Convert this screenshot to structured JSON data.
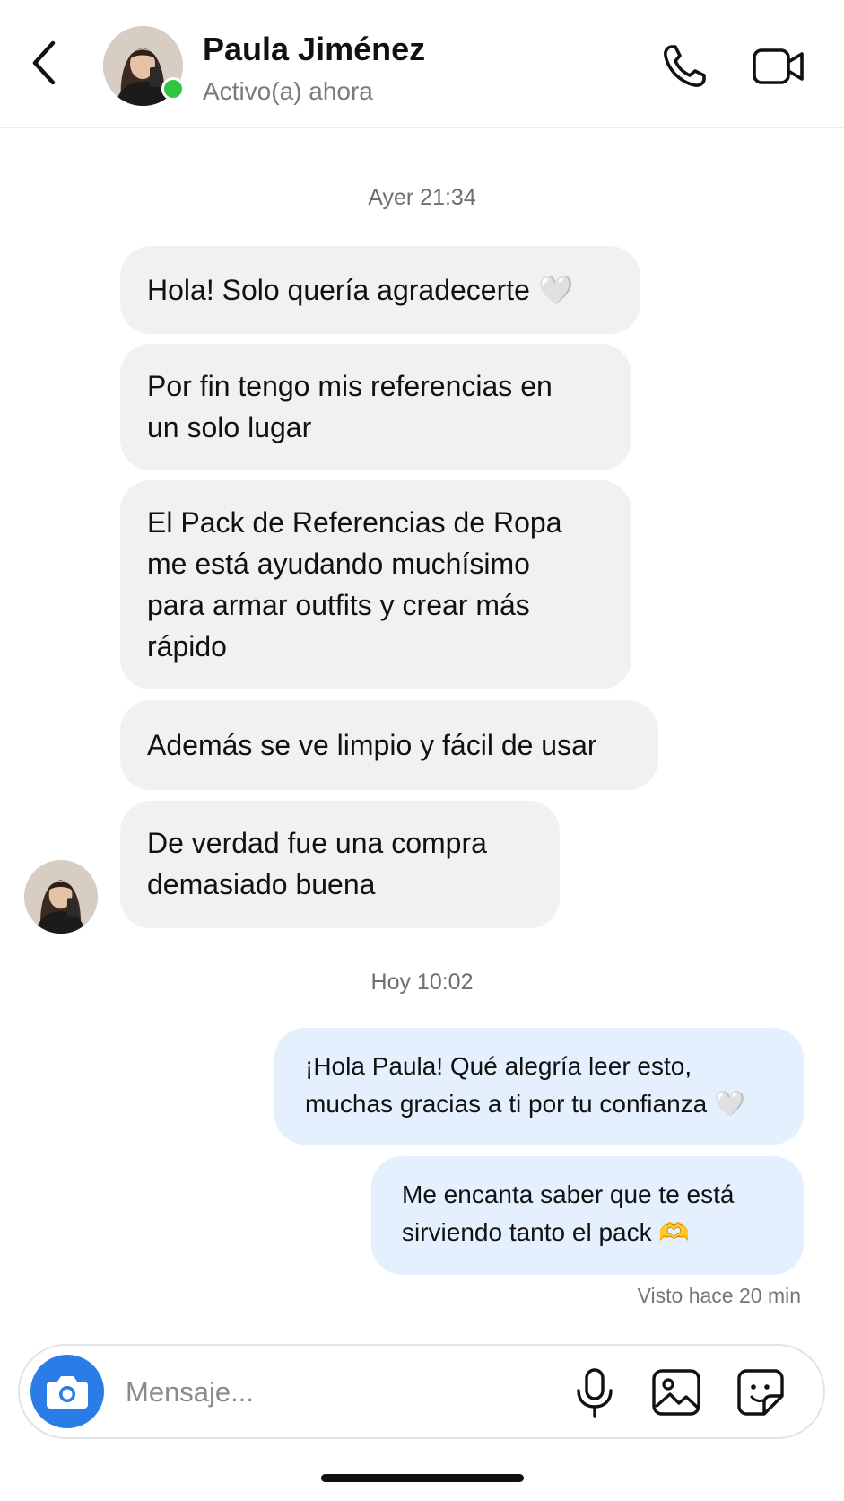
{
  "header": {
    "name": "Paula Jiménez",
    "status": "Activo(a) ahora"
  },
  "conversation": {
    "day1_timestamp": "Ayer 21:34",
    "incoming": [
      "Hola! Solo quería agradecerte 🤍",
      "Por fin tengo mis referencias en\nun solo lugar",
      "El Pack de Referencias de Ropa\nme está ayudando muchísimo\npara armar outfits y crear más\nrápido",
      "Además se ve limpio y fácil de usar",
      "De verdad fue una compra\ndemasiado buena"
    ],
    "day2_timestamp": "Hoy 10:02",
    "outgoing": [
      "¡Hola Paula! Qué alegría leer esto,\nmuchas gracias a ti por tu confianza 🤍",
      "Me encanta saber que te está\nsirviendo tanto el pack 🫶"
    ],
    "seen": "Visto hace 20 min"
  },
  "composer": {
    "placeholder": "Mensaje..."
  },
  "colors": {
    "accent": "#2a7de6",
    "online": "#2fc53f",
    "incoming_bubble": "#f1f1f1",
    "outgoing_bubble": "#e4f0fd"
  },
  "icons": {
    "back": "chevron-left-icon",
    "call": "phone-icon",
    "video": "video-camera-icon",
    "camera": "camera-icon",
    "mic": "microphone-icon",
    "gallery": "image-icon",
    "sticker": "sticker-icon"
  }
}
